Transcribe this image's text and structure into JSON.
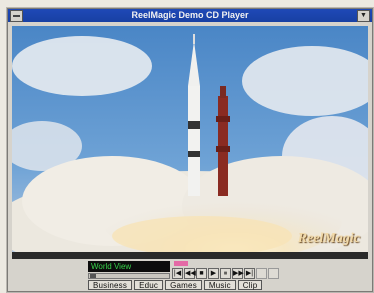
{
  "window": {
    "title": "ReelMagic Demo CD Player"
  },
  "video": {
    "watermark": "ReelMagic"
  },
  "player": {
    "display_text": "World View",
    "transport": [
      {
        "name": "skip-back-icon",
        "glyph": "|◀"
      },
      {
        "name": "rewind-icon",
        "glyph": "◀◀"
      },
      {
        "name": "stop-icon",
        "glyph": "■"
      },
      {
        "name": "play-icon",
        "glyph": "▶"
      },
      {
        "name": "pause-icon",
        "glyph": "⏸"
      },
      {
        "name": "fast-forward-icon",
        "glyph": "▶▶"
      },
      {
        "name": "skip-forward-icon",
        "glyph": "▶|"
      }
    ]
  },
  "tabs": [
    "Business",
    "Educ",
    "Games",
    "Music",
    "Clip"
  ]
}
